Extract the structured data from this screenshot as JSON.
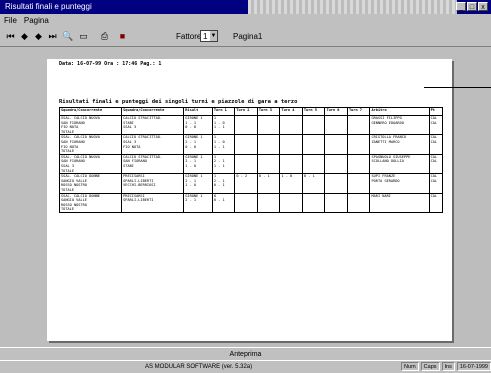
{
  "window": {
    "title": "Risultati finali e punteggi"
  },
  "menu": [
    "File",
    "Pagina"
  ],
  "toolbar": {
    "buttons": [
      {
        "name": "first-page-icon",
        "glyph": "⏮"
      },
      {
        "name": "prev-page-icon",
        "glyph": "◆"
      },
      {
        "name": "next-page-icon",
        "glyph": "◆"
      },
      {
        "name": "last-page-icon",
        "glyph": "⏭"
      },
      {
        "name": "zoom-icon",
        "glyph": "🔍"
      },
      {
        "name": "fit-page-icon",
        "glyph": "▭"
      },
      {
        "name": "print-icon",
        "glyph": "⎙"
      },
      {
        "name": "close-book-icon",
        "glyph": "■"
      }
    ],
    "zoom_label": "Fattore",
    "zoom_value": "1",
    "page_label": "Pagina1"
  },
  "report": {
    "header": "Data: 16-07-99   Ora : 17:46 Pag.: 1",
    "title": "Risultati finali e punteggi dei singoli turni e piazzole di gara a terzo",
    "columns": [
      "Squadra/Concorrente",
      "Squadra/Concorrente",
      "Risult",
      "Turn 1",
      "Turn 2",
      "Turn 3",
      "Turn 4",
      "Turn 5",
      "Turn 6",
      "Turn 7",
      "Arbitro",
      "Pt"
    ],
    "rows": [
      [
        "SSAL. CALCIO NUOVA\nSAN FIORANO\nFIO NOTA\nTOTALE",
        "CALCIO STRACITTAD.\nSTABI\nSSAL 3",
        "GIRONE 1\n1 - 1\n0 - 0",
        "1\n1 - 0\n1 - 1",
        "",
        "",
        "",
        "",
        "",
        "",
        "GRASSI FILIPPO\nGENNERO EDOARDO",
        "CAL\nCAL"
      ],
      [
        "SSAL. CALCIO NUOVA\nSAN FIORANO\nFIO NOTA\nTOTALE",
        "CALCIO STRACITTAD.\nSSAL 3\nFIO NOTA",
        "GIRONE 1\n2 - 1\n0 - 0",
        "1\n1 - 0\n1 - 1",
        "",
        "",
        "",
        "",
        "",
        "",
        "CRISTOLLA FRANCO\nZANETTI MARCO",
        "CAL\nCAL"
      ],
      [
        "SSAL. CALCIO NUOVA\nSAN FIORANO\nSSAL 3\nTOTALE",
        "CALCIO STRACITTAD.\nSAN FIORANO\nSTABI",
        "GIRONE 1\n2 - 1\n1 - 0",
        "1\n2 - 1\n1 - 1",
        "",
        "",
        "",
        "",
        "",
        "",
        "SPAGNUOLO GIUSEPPE\nSCOLLANO DOLLIA",
        "CAL\nCAL"
      ],
      [
        "SSAL. CALCIO DONNE\nSANGIO VALLE\nROSSO NOSTRO\nTOTALE",
        "PRECISARSI\nSPARLI-LIBERTI\nVECCHI-BERRIOSI",
        "GIRONE 1\n2 - 1\n1 - 0",
        "1\n2 - 1\n0 - 1",
        "0 - 2",
        "0 - 1",
        "1 - 0",
        "0 - 1",
        "",
        "",
        "SUPI FRANZE\nPORTA GERARDO",
        "CAL\nCAL"
      ],
      [
        "SSAL. CALCIO DONNE\nSANGIO VALLE\nROSSO NOSTRO\nTOTALE",
        "PRECISARSI\nSPARLI-LIBERTI",
        "GIRONE 1\n2 - 1",
        "0\n0 - 1",
        "",
        "",
        "",
        "",
        "",
        "",
        "MARI NARI",
        "CAL"
      ]
    ]
  },
  "status": {
    "text": "Anteprima"
  },
  "taskbar": {
    "vendor": "AS MODULAR SOFTWARE   (ver. 5.32a)",
    "cells": [
      "Num",
      "Caps",
      "Ins",
      "16-07-1999"
    ]
  }
}
